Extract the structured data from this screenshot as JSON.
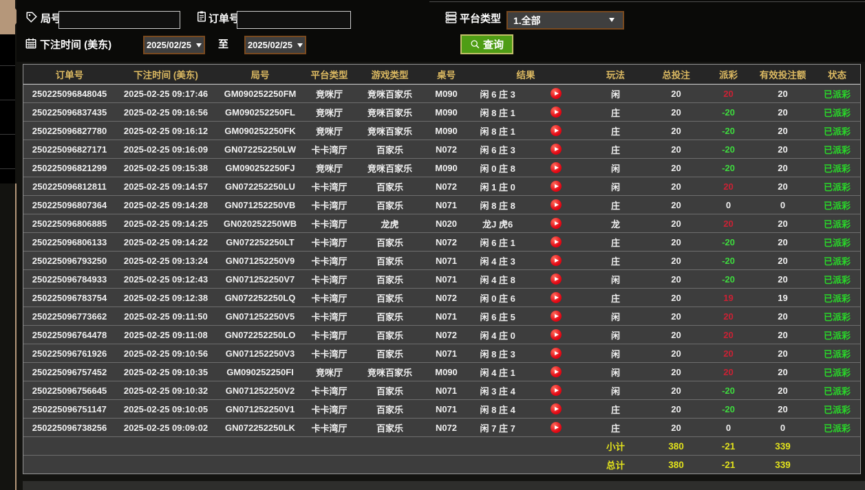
{
  "filters": {
    "round_label": "局号",
    "round_value": "",
    "order_label": "订单号",
    "order_value": "",
    "bet_time_label": "下注时间 (美东)",
    "date_from": "2025/02/25",
    "to_label": "至",
    "date_to": "2025/02/25",
    "platform_label": "平台类型",
    "platform_selected": "1.全部",
    "search_label": "查询"
  },
  "table": {
    "headers": [
      "订单号",
      "下注时间 (美东)",
      "局号",
      "平台类型",
      "游戏类型",
      "桌号",
      "结果",
      "玩法",
      "总投注",
      "派彩",
      "有效投注额",
      "状态"
    ],
    "rows": [
      {
        "order": "250225096848045",
        "time": "2025-02-25 09:17:46",
        "round": "GM090252250FM",
        "platform": "竞咪厅",
        "game": "竞咪百家乐",
        "table_no": "M090",
        "result": "闲 6 庄 3",
        "bet": "闲",
        "total_bet": "20",
        "payout": "20",
        "payout_class": "pos",
        "valid_bet": "20",
        "status": "已派彩"
      },
      {
        "order": "250225096837435",
        "time": "2025-02-25 09:16:56",
        "round": "GM090252250FL",
        "platform": "竞咪厅",
        "game": "竞咪百家乐",
        "table_no": "M090",
        "result": "闲 8 庄 1",
        "bet": "庄",
        "total_bet": "20",
        "payout": "-20",
        "payout_class": "neg",
        "valid_bet": "20",
        "status": "已派彩"
      },
      {
        "order": "250225096827780",
        "time": "2025-02-25 09:16:12",
        "round": "GM090252250FK",
        "platform": "竞咪厅",
        "game": "竞咪百家乐",
        "table_no": "M090",
        "result": "闲 8 庄 1",
        "bet": "庄",
        "total_bet": "20",
        "payout": "-20",
        "payout_class": "neg",
        "valid_bet": "20",
        "status": "已派彩"
      },
      {
        "order": "250225096827171",
        "time": "2025-02-25 09:16:09",
        "round": "GN072252250LW",
        "platform": "卡卡湾厅",
        "game": "百家乐",
        "table_no": "N072",
        "result": "闲 6 庄 3",
        "bet": "庄",
        "total_bet": "20",
        "payout": "-20",
        "payout_class": "neg",
        "valid_bet": "20",
        "status": "已派彩"
      },
      {
        "order": "250225096821299",
        "time": "2025-02-25 09:15:38",
        "round": "GM090252250FJ",
        "platform": "竞咪厅",
        "game": "竞咪百家乐",
        "table_no": "M090",
        "result": "闲 0 庄 8",
        "bet": "闲",
        "total_bet": "20",
        "payout": "-20",
        "payout_class": "neg",
        "valid_bet": "20",
        "status": "已派彩"
      },
      {
        "order": "250225096812811",
        "time": "2025-02-25 09:14:57",
        "round": "GN072252250LU",
        "platform": "卡卡湾厅",
        "game": "百家乐",
        "table_no": "N072",
        "result": "闲 1 庄 0",
        "bet": "闲",
        "total_bet": "20",
        "payout": "20",
        "payout_class": "pos",
        "valid_bet": "20",
        "status": "已派彩"
      },
      {
        "order": "250225096807364",
        "time": "2025-02-25 09:14:28",
        "round": "GN071252250VB",
        "platform": "卡卡湾厅",
        "game": "百家乐",
        "table_no": "N071",
        "result": "闲 8 庄 8",
        "bet": "庄",
        "total_bet": "20",
        "payout": "0",
        "payout_class": "zero",
        "valid_bet": "0",
        "status": "已派彩"
      },
      {
        "order": "250225096806885",
        "time": "2025-02-25 09:14:25",
        "round": "GN020252250WB",
        "platform": "卡卡湾厅",
        "game": "龙虎",
        "table_no": "N020",
        "result": "龙J 虎6",
        "bet": "龙",
        "total_bet": "20",
        "payout": "20",
        "payout_class": "pos",
        "valid_bet": "20",
        "status": "已派彩"
      },
      {
        "order": "250225096806133",
        "time": "2025-02-25 09:14:22",
        "round": "GN072252250LT",
        "platform": "卡卡湾厅",
        "game": "百家乐",
        "table_no": "N072",
        "result": "闲 6 庄 1",
        "bet": "庄",
        "total_bet": "20",
        "payout": "-20",
        "payout_class": "neg",
        "valid_bet": "20",
        "status": "已派彩"
      },
      {
        "order": "250225096793250",
        "time": "2025-02-25 09:13:24",
        "round": "GN071252250V9",
        "platform": "卡卡湾厅",
        "game": "百家乐",
        "table_no": "N071",
        "result": "闲 4 庄 3",
        "bet": "庄",
        "total_bet": "20",
        "payout": "-20",
        "payout_class": "neg",
        "valid_bet": "20",
        "status": "已派彩"
      },
      {
        "order": "250225096784933",
        "time": "2025-02-25 09:12:43",
        "round": "GN071252250V7",
        "platform": "卡卡湾厅",
        "game": "百家乐",
        "table_no": "N071",
        "result": "闲 4 庄 8",
        "bet": "闲",
        "total_bet": "20",
        "payout": "-20",
        "payout_class": "neg",
        "valid_bet": "20",
        "status": "已派彩"
      },
      {
        "order": "250225096783754",
        "time": "2025-02-25 09:12:38",
        "round": "GN072252250LQ",
        "platform": "卡卡湾厅",
        "game": "百家乐",
        "table_no": "N072",
        "result": "闲 0 庄 6",
        "bet": "庄",
        "total_bet": "20",
        "payout": "19",
        "payout_class": "pos",
        "valid_bet": "19",
        "status": "已派彩"
      },
      {
        "order": "250225096773662",
        "time": "2025-02-25 09:11:50",
        "round": "GN071252250V5",
        "platform": "卡卡湾厅",
        "game": "百家乐",
        "table_no": "N071",
        "result": "闲 6 庄 5",
        "bet": "闲",
        "total_bet": "20",
        "payout": "20",
        "payout_class": "pos",
        "valid_bet": "20",
        "status": "已派彩"
      },
      {
        "order": "250225096764478",
        "time": "2025-02-25 09:11:08",
        "round": "GN072252250LO",
        "platform": "卡卡湾厅",
        "game": "百家乐",
        "table_no": "N072",
        "result": "闲 4 庄 0",
        "bet": "闲",
        "total_bet": "20",
        "payout": "20",
        "payout_class": "pos",
        "valid_bet": "20",
        "status": "已派彩"
      },
      {
        "order": "250225096761926",
        "time": "2025-02-25 09:10:56",
        "round": "GN071252250V3",
        "platform": "卡卡湾厅",
        "game": "百家乐",
        "table_no": "N071",
        "result": "闲 8 庄 3",
        "bet": "闲",
        "total_bet": "20",
        "payout": "20",
        "payout_class": "pos",
        "valid_bet": "20",
        "status": "已派彩"
      },
      {
        "order": "250225096757452",
        "time": "2025-02-25 09:10:35",
        "round": "GM090252250FI",
        "platform": "竞咪厅",
        "game": "竞咪百家乐",
        "table_no": "M090",
        "result": "闲 4 庄 1",
        "bet": "闲",
        "total_bet": "20",
        "payout": "20",
        "payout_class": "pos",
        "valid_bet": "20",
        "status": "已派彩"
      },
      {
        "order": "250225096756645",
        "time": "2025-02-25 09:10:32",
        "round": "GN071252250V2",
        "platform": "卡卡湾厅",
        "game": "百家乐",
        "table_no": "N071",
        "result": "闲 3 庄 4",
        "bet": "闲",
        "total_bet": "20",
        "payout": "-20",
        "payout_class": "neg",
        "valid_bet": "20",
        "status": "已派彩"
      },
      {
        "order": "250225096751147",
        "time": "2025-02-25 09:10:05",
        "round": "GN071252250V1",
        "platform": "卡卡湾厅",
        "game": "百家乐",
        "table_no": "N071",
        "result": "闲 8 庄 4",
        "bet": "庄",
        "total_bet": "20",
        "payout": "-20",
        "payout_class": "neg",
        "valid_bet": "20",
        "status": "已派彩"
      },
      {
        "order": "250225096738256",
        "time": "2025-02-25 09:09:02",
        "round": "GN072252250LK",
        "platform": "卡卡湾厅",
        "game": "百家乐",
        "table_no": "N072",
        "result": "闲 7 庄 7",
        "bet": "庄",
        "total_bet": "20",
        "payout": "0",
        "payout_class": "zero",
        "valid_bet": "0",
        "status": "已派彩"
      }
    ],
    "subtotal": {
      "label": "小计",
      "total_bet": "380",
      "payout": "-21",
      "valid_bet": "339"
    },
    "grand_total": {
      "label": "总计",
      "total_bet": "380",
      "payout": "-21",
      "valid_bet": "339"
    }
  },
  "colors": {
    "accent_gold": "#dab861",
    "status_green": "#29d829",
    "payout_win_red": "#cb2134",
    "payout_loss_green": "#3edb3e",
    "totals_yellow": "#e2e21c",
    "button_green": "#4f9d15",
    "dropdown_border_orange": "#7a4a1f",
    "active_tab_tan": "#b5977a"
  }
}
